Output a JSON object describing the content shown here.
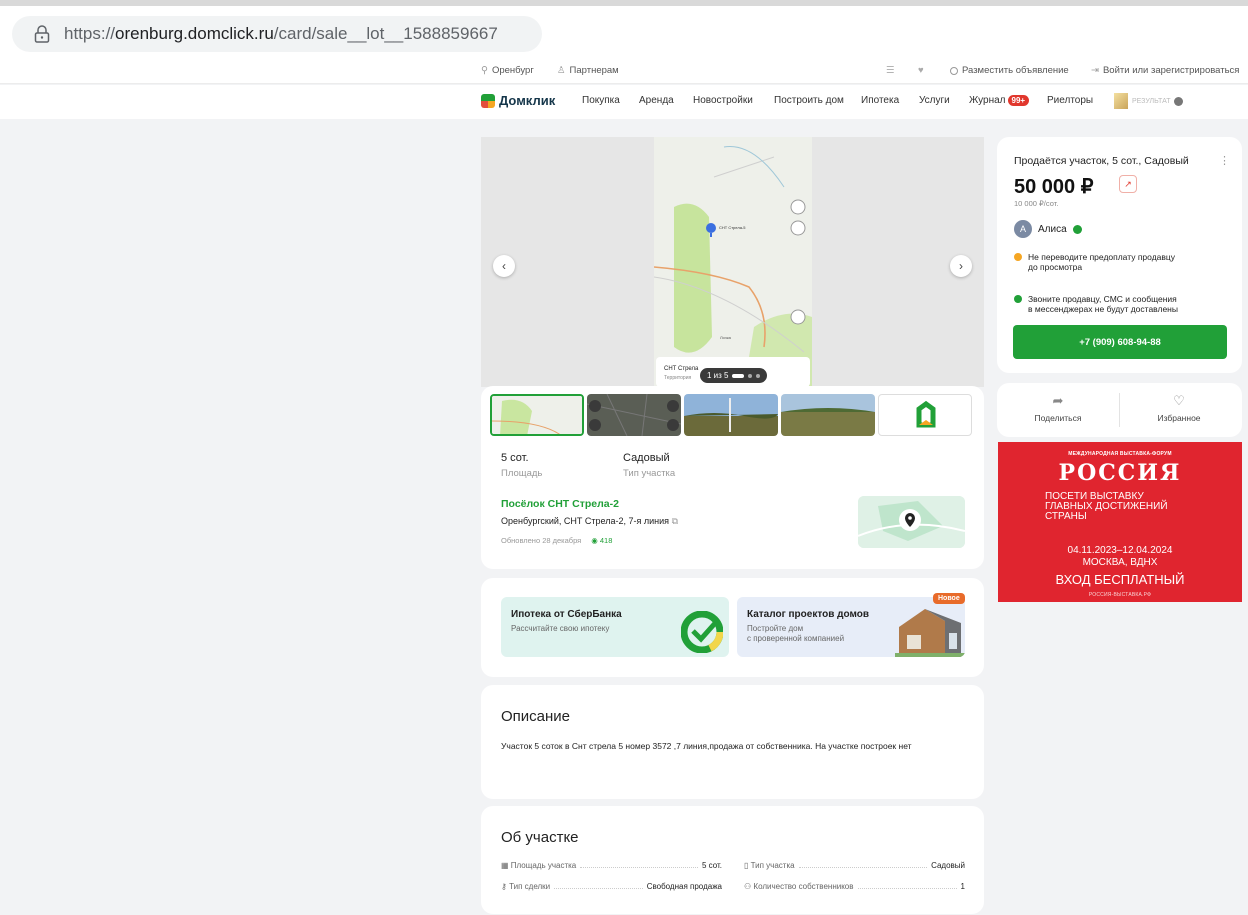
{
  "browser": {
    "url_prefix": "https://",
    "url_host": "orenburg.domclick.ru",
    "url_path": "/card/sale__lot__1588859667"
  },
  "topstrip": {
    "city": "Оренбург",
    "partners": "Партнерам",
    "post_ad": "Разместить объявление",
    "login": "Войти или зарегистрироваться"
  },
  "nav": {
    "logo": "Домклик",
    "items": [
      "Покупка",
      "Аренда",
      "Новостройки",
      "Построить дом",
      "Ипотека",
      "Услуги",
      "Журнал",
      "Риелторы"
    ],
    "journal_badge": "99+",
    "sponsor": "РЕЗУЛЬТАТ"
  },
  "gallery": {
    "map_label": "СНТ Стрела-5",
    "map_label2": "Лочка",
    "bottom_title": "СНТ Стрела",
    "bottom_sub": "Территория",
    "counter": "1 из 5"
  },
  "listing": {
    "area_value": "5 сот.",
    "area_label": "Площадь",
    "type_value": "Садовый",
    "type_label": "Тип участка",
    "village": "Посёлок СНТ Стрела-2",
    "address": "Оренбургский, СНТ Стрела-2, 7-я линия",
    "updated": "Обновлено 28 декабря",
    "views": "418"
  },
  "promos": {
    "mortgage_title": "Ипотека от СберБанка",
    "mortgage_sub": "Рассчитайте свою ипотеку",
    "catalog_title": "Каталог проектов домов",
    "catalog_sub1": "Постройте дом",
    "catalog_sub2": "с проверенной компанией",
    "new_badge": "Новое"
  },
  "description": {
    "title": "Описание",
    "text": "Участок 5 соток в Снт стрела 5 номер 3572 ,7 линия,продажа от собственника. На участке построек нет"
  },
  "about": {
    "title": "Об участке",
    "rows": [
      {
        "label": "Площадь участка",
        "value": "5 сот."
      },
      {
        "label": "Тип участка",
        "value": "Садовый"
      },
      {
        "label": "Тип сделки",
        "value": "Свободная продажа"
      },
      {
        "label": "Количество собственников",
        "value": "1"
      }
    ]
  },
  "offer": {
    "title": "Продаётся участок, 5 сот., Садовый",
    "price": "50 000 ₽",
    "price_per_unit": "10 000 ₽/сот.",
    "seller_initial": "А",
    "seller_name": "Алиса",
    "warn1_line1": "Не переводите предоплату продавцу",
    "warn1_line2": "до просмотра",
    "warn2_line1": "Звоните продавцу, СМС и сообщения",
    "warn2_line2": "в мессенджерах не будут доставлены",
    "phone": "+7 (909) 608-94-88",
    "share": "Поделиться",
    "favorite": "Избранное"
  },
  "ad": {
    "top": "МЕЖДУНАРОДНАЯ ВЫСТАВКА-ФОРУМ",
    "brand": "РОССИЯ",
    "slogan1": "ПОСЕТИ ВЫСТАВКУ",
    "slogan2": "ГЛАВНЫХ ДОСТИЖЕНИЙ",
    "slogan3": "СТРАНЫ",
    "dates": "04.11.2023–12.04.2024",
    "place": "МОСКВА, ВДНХ",
    "free": "ВХОД БЕСПЛАТНЫЙ",
    "footer": "РОССИЯ-ВЫСТАВКА.РФ"
  },
  "colors": {
    "accent_green": "#21a038",
    "ad_red": "#e0252f",
    "badge_red": "#e1372d"
  }
}
